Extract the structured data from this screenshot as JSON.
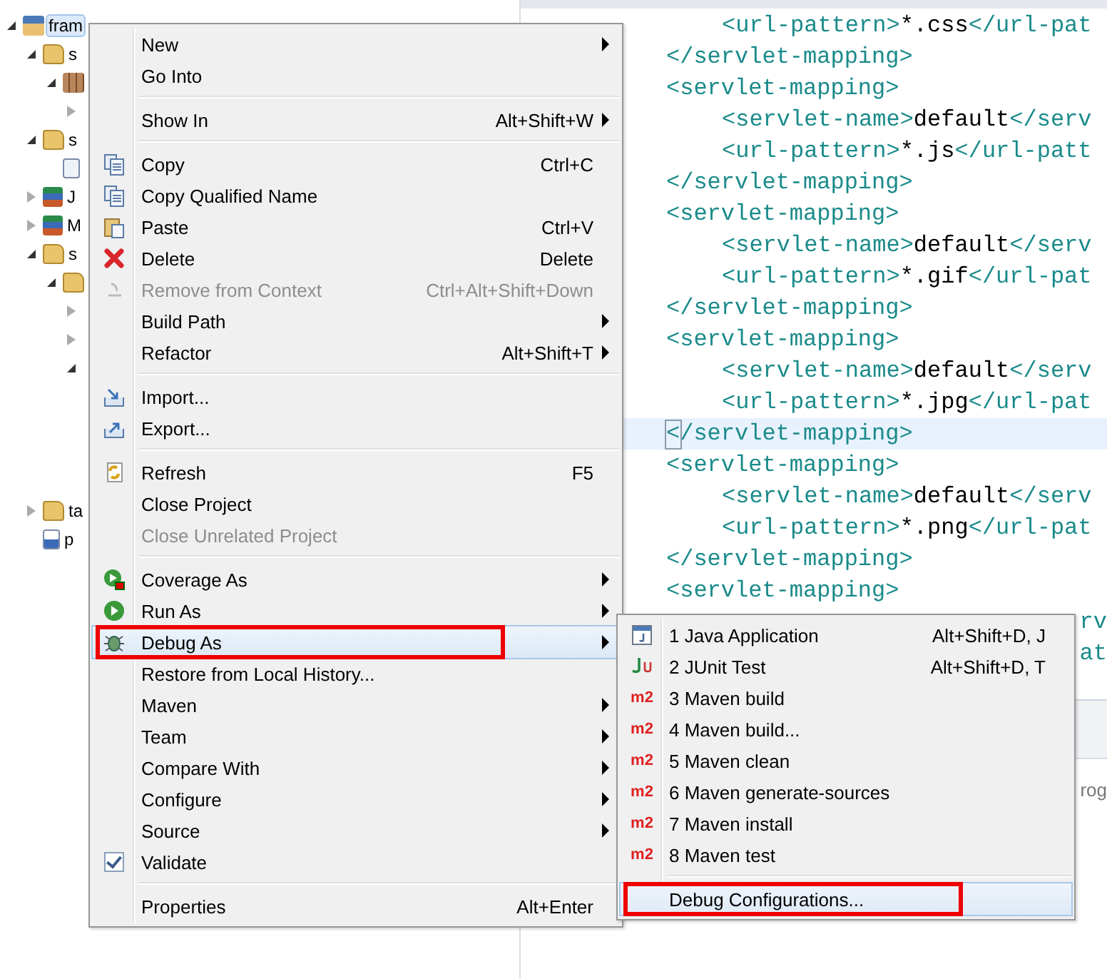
{
  "tree": {
    "items": [
      {
        "label": "fram",
        "kind": "project",
        "expanded": true,
        "selected": true,
        "children": [
          {
            "label": "s",
            "kind": "source-folder",
            "expanded": true,
            "selected": false,
            "children": [
              {
                "kind": "package",
                "expanded": true,
                "children": [
                  {
                    "expanded": false
                  }
                ]
              }
            ]
          },
          {
            "label": "s",
            "kind": "source-folder",
            "expanded": true,
            "selected": false,
            "children": [
              {
                "kind": "xml-file"
              }
            ]
          },
          {
            "label": "J",
            "kind": "library",
            "expanded": false,
            "selected": false
          },
          {
            "label": "M",
            "kind": "library",
            "expanded": false,
            "selected": false
          },
          {
            "label": "s",
            "kind": "folder",
            "expanded": true,
            "selected": false,
            "children": [
              {
                "kind": "folder",
                "expanded": true,
                "children": [
                  {
                    "expanded": false
                  },
                  {
                    "expanded": false
                  },
                  {
                    "expanded": true
                  }
                ]
              }
            ]
          },
          {
            "label": "ta",
            "kind": "folder",
            "expanded": false,
            "selected": false
          },
          {
            "label": "p",
            "kind": "maven-file",
            "selected": false
          }
        ]
      }
    ]
  },
  "editor": {
    "lines": [
      {
        "kind": "inner",
        "current": false,
        "segments": [
          {
            "kind": "tag",
            "text": "<url-pattern>"
          },
          {
            "kind": "text",
            "text": "*.css"
          },
          {
            "kind": "tag",
            "text": "</url-pat"
          }
        ]
      },
      {
        "kind": "outer",
        "current": false,
        "segments": [
          {
            "kind": "tag",
            "text": "</servlet-mapping>"
          }
        ]
      },
      {
        "kind": "outer",
        "current": false,
        "segments": [
          {
            "kind": "tag",
            "text": "<servlet-mapping>"
          }
        ]
      },
      {
        "kind": "inner",
        "current": false,
        "segments": [
          {
            "kind": "tag",
            "text": "<servlet-name>"
          },
          {
            "kind": "text",
            "text": "default"
          },
          {
            "kind": "tag",
            "text": "</serv"
          }
        ]
      },
      {
        "kind": "inner",
        "current": false,
        "segments": [
          {
            "kind": "tag",
            "text": "<url-pattern>"
          },
          {
            "kind": "text",
            "text": "*.js"
          },
          {
            "kind": "tag",
            "text": "</url-patt"
          }
        ]
      },
      {
        "kind": "outer",
        "current": false,
        "segments": [
          {
            "kind": "tag",
            "text": "</servlet-mapping>"
          }
        ]
      },
      {
        "kind": "outer",
        "current": false,
        "segments": [
          {
            "kind": "tag",
            "text": "<servlet-mapping>"
          }
        ]
      },
      {
        "kind": "inner",
        "current": false,
        "segments": [
          {
            "kind": "tag",
            "text": "<servlet-name>"
          },
          {
            "kind": "text",
            "text": "default"
          },
          {
            "kind": "tag",
            "text": "</serv"
          }
        ]
      },
      {
        "kind": "inner",
        "current": false,
        "segments": [
          {
            "kind": "tag",
            "text": "<url-pattern>"
          },
          {
            "kind": "text",
            "text": "*.gif"
          },
          {
            "kind": "tag",
            "text": "</url-pat"
          }
        ]
      },
      {
        "kind": "outer",
        "current": false,
        "segments": [
          {
            "kind": "tag",
            "text": "</servlet-mapping>"
          }
        ]
      },
      {
        "kind": "outer",
        "current": false,
        "segments": [
          {
            "kind": "tag",
            "text": "<servlet-mapping>"
          }
        ]
      },
      {
        "kind": "inner",
        "current": false,
        "segments": [
          {
            "kind": "tag",
            "text": "<servlet-name>"
          },
          {
            "kind": "text",
            "text": "default"
          },
          {
            "kind": "tag",
            "text": "</serv"
          }
        ]
      },
      {
        "kind": "inner",
        "current": false,
        "segments": [
          {
            "kind": "tag",
            "text": "<url-pattern>"
          },
          {
            "kind": "text",
            "text": "*.jpg"
          },
          {
            "kind": "tag",
            "text": "</url-pat"
          }
        ]
      },
      {
        "kind": "outer",
        "current": true,
        "segments": [
          {
            "kind": "tag",
            "text": "</servlet-mapping>"
          }
        ]
      },
      {
        "kind": "outer",
        "current": false,
        "segments": [
          {
            "kind": "tag",
            "text": "<servlet-mapping>"
          }
        ]
      },
      {
        "kind": "inner",
        "current": false,
        "segments": [
          {
            "kind": "tag",
            "text": "<servlet-name>"
          },
          {
            "kind": "text",
            "text": "default"
          },
          {
            "kind": "tag",
            "text": "</serv"
          }
        ]
      },
      {
        "kind": "inner",
        "current": false,
        "segments": [
          {
            "kind": "tag",
            "text": "<url-pattern>"
          },
          {
            "kind": "text",
            "text": "*.png"
          },
          {
            "kind": "tag",
            "text": "</url-pat"
          }
        ]
      },
      {
        "kind": "outer",
        "current": false,
        "segments": [
          {
            "kind": "tag",
            "text": "</servlet-mapping>"
          }
        ]
      },
      {
        "kind": "outer",
        "current": false,
        "segments": [
          {
            "kind": "tag",
            "text": "<servlet-mapping>"
          }
        ]
      },
      {
        "kind": "peek",
        "current": false,
        "segments": [
          {
            "kind": "tag",
            "text": "rv"
          }
        ]
      },
      {
        "kind": "peek",
        "current": false,
        "segments": [
          {
            "kind": "tag",
            "text": "at"
          }
        ]
      }
    ]
  },
  "bottom_panel": {
    "text": "rog"
  },
  "context_menu": {
    "groups": [
      [
        {
          "label": "New",
          "submenu": true,
          "disabled": false,
          "selected": false,
          "annotated": false
        },
        {
          "label": "Go Into",
          "submenu": false,
          "disabled": false,
          "selected": false,
          "annotated": false
        }
      ],
      [
        {
          "label": "Show In",
          "shortcut": "Alt+Shift+W",
          "submenu": true,
          "disabled": false,
          "selected": false,
          "annotated": false
        }
      ],
      [
        {
          "label": "Copy",
          "kind": "copy",
          "shortcut": "Ctrl+C",
          "submenu": false,
          "disabled": false,
          "selected": false,
          "annotated": false
        },
        {
          "label": "Copy Qualified Name",
          "kind": "copy-name",
          "submenu": false,
          "disabled": false,
          "selected": false,
          "annotated": false
        },
        {
          "label": "Paste",
          "kind": "paste",
          "shortcut": "Ctrl+V",
          "submenu": false,
          "disabled": false,
          "selected": false,
          "annotated": false
        },
        {
          "label": "Delete",
          "kind": "delete",
          "shortcut": "Delete",
          "submenu": false,
          "disabled": false,
          "selected": false,
          "annotated": false
        },
        {
          "label": "Remove from Context",
          "kind": "remove",
          "shortcut": "Ctrl+Alt+Shift+Down",
          "submenu": false,
          "disabled": true,
          "selected": false,
          "annotated": false
        },
        {
          "label": "Build Path",
          "submenu": true,
          "disabled": false,
          "selected": false,
          "annotated": false
        },
        {
          "label": "Refactor",
          "shortcut": "Alt+Shift+T",
          "submenu": true,
          "disabled": false,
          "selected": false,
          "annotated": false
        }
      ],
      [
        {
          "label": "Import...",
          "kind": "import",
          "submenu": false,
          "disabled": false,
          "selected": false,
          "annotated": false
        },
        {
          "label": "Export...",
          "kind": "export",
          "submenu": false,
          "disabled": false,
          "selected": false,
          "annotated": false
        }
      ],
      [
        {
          "label": "Refresh",
          "kind": "refresh",
          "shortcut": "F5",
          "submenu": false,
          "disabled": false,
          "selected": false,
          "annotated": false
        },
        {
          "label": "Close Project",
          "submenu": false,
          "disabled": false,
          "selected": false,
          "annotated": false
        },
        {
          "label": "Close Unrelated Project",
          "submenu": false,
          "disabled": true,
          "selected": false,
          "annotated": false
        }
      ],
      [
        {
          "label": "Coverage As",
          "kind": "coverage",
          "submenu": true,
          "disabled": false,
          "selected": false,
          "annotated": false
        },
        {
          "label": "Run As",
          "kind": "run",
          "submenu": true,
          "disabled": false,
          "selected": false,
          "annotated": false
        },
        {
          "label": "Debug As",
          "kind": "debug",
          "submenu": true,
          "disabled": false,
          "selected": true,
          "annotated": true
        },
        {
          "label": "Restore from Local History...",
          "submenu": false,
          "disabled": false,
          "selected": false,
          "annotated": false
        },
        {
          "label": "Maven",
          "submenu": true,
          "disabled": false,
          "selected": false,
          "annotated": false
        },
        {
          "label": "Team",
          "submenu": true,
          "disabled": false,
          "selected": false,
          "annotated": false
        },
        {
          "label": "Compare With",
          "submenu": true,
          "disabled": false,
          "selected": false,
          "annotated": false
        },
        {
          "label": "Configure",
          "submenu": true,
          "disabled": false,
          "selected": false,
          "annotated": false
        },
        {
          "label": "Source",
          "submenu": true,
          "disabled": false,
          "selected": false,
          "annotated": false
        },
        {
          "label": "Validate",
          "kind": "checkbox",
          "checked": true,
          "submenu": false,
          "disabled": false,
          "selected": false,
          "annotated": false
        }
      ],
      [
        {
          "label": "Properties",
          "shortcut": "Alt+Enter",
          "submenu": false,
          "disabled": false,
          "selected": false,
          "annotated": false
        }
      ]
    ]
  },
  "submenu": {
    "groups": [
      [
        {
          "label": "1 Java Application",
          "kind": "java",
          "shortcut": "Alt+Shift+D, J",
          "selected": false,
          "annotated": false
        },
        {
          "label": "2 JUnit Test",
          "kind": "junit",
          "shortcut": "Alt+Shift+D, T",
          "selected": false,
          "annotated": false
        },
        {
          "label": "3 Maven build",
          "kind": "maven",
          "badge": "m2",
          "selected": false,
          "annotated": false
        },
        {
          "label": "4 Maven build...",
          "kind": "maven",
          "badge": "m2",
          "selected": false,
          "annotated": false
        },
        {
          "label": "5 Maven clean",
          "kind": "maven",
          "badge": "m2",
          "selected": false,
          "annotated": false
        },
        {
          "label": "6 Maven generate-sources",
          "kind": "maven",
          "badge": "m2",
          "selected": false,
          "annotated": false
        },
        {
          "label": "7 Maven install",
          "kind": "maven",
          "badge": "m2",
          "selected": false,
          "annotated": false
        },
        {
          "label": "8 Maven test",
          "kind": "maven",
          "badge": "m2",
          "selected": false,
          "annotated": false
        }
      ],
      [
        {
          "label": "Debug Configurations...",
          "selected": true,
          "annotated": true
        }
      ]
    ]
  }
}
